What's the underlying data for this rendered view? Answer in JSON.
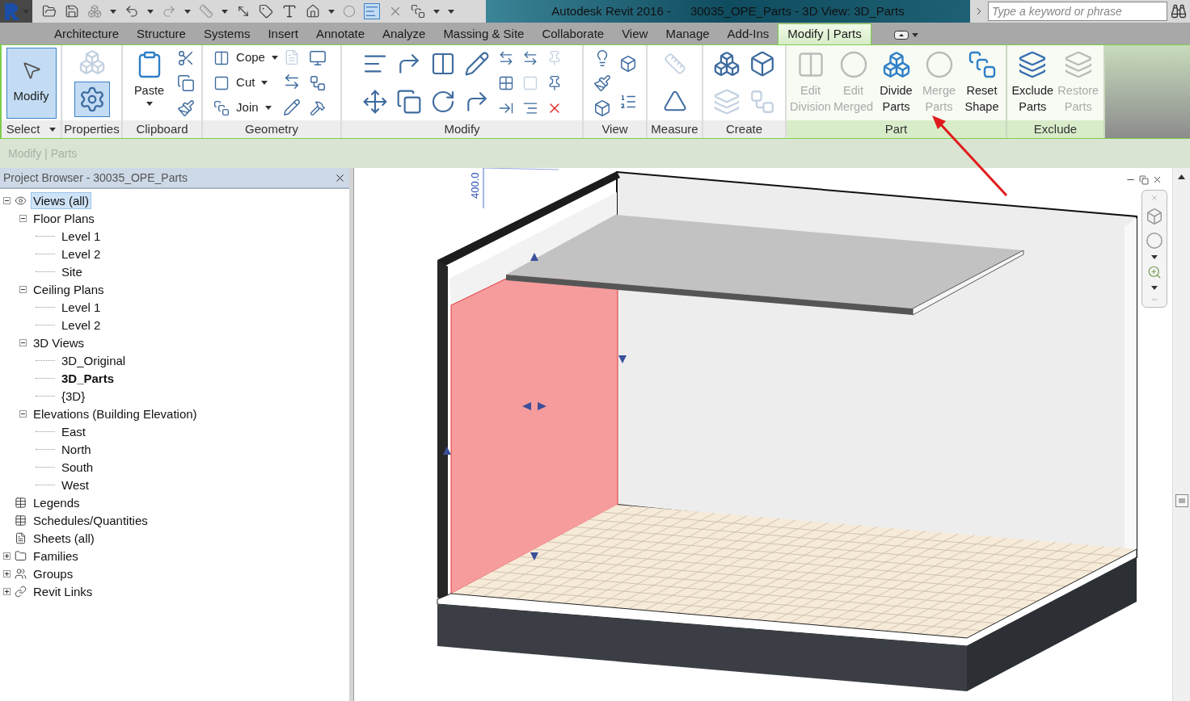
{
  "title_bar": {
    "app_name": "Autodesk Revit 2016 -",
    "document": "30035_OPE_Parts - 3D View: 3D_Parts",
    "search": {
      "placeholder": "Type a keyword or phrase"
    }
  },
  "tabs": [
    {
      "label": "Architecture",
      "selected": false
    },
    {
      "label": "Structure",
      "selected": false
    },
    {
      "label": "Systems",
      "selected": false
    },
    {
      "label": "Insert",
      "selected": false
    },
    {
      "label": "Annotate",
      "selected": false
    },
    {
      "label": "Analyze",
      "selected": false
    },
    {
      "label": "Massing & Site",
      "selected": false
    },
    {
      "label": "Collaborate",
      "selected": false
    },
    {
      "label": "View",
      "selected": false
    },
    {
      "label": "Manage",
      "selected": false
    },
    {
      "label": "Add-Ins",
      "selected": false
    },
    {
      "label": "Modify | Parts",
      "selected": true
    }
  ],
  "ribbon": {
    "panels": [
      {
        "title": "Select",
        "dropdown": true,
        "contextual": false,
        "tools": [
          {
            "kind": "large",
            "label": "Modify",
            "selected": true,
            "dropdown": false,
            "disabled": false
          }
        ]
      },
      {
        "title": "Properties",
        "dropdown": false,
        "contextual": false
      },
      {
        "title": "Clipboard",
        "dropdown": false,
        "contextual": false,
        "tools": [
          {
            "kind": "large",
            "label": "Paste",
            "dropdown": true,
            "disabled": false
          }
        ]
      },
      {
        "title": "Geometry",
        "dropdown": false,
        "contextual": false,
        "tools": [
          {
            "kind": "row",
            "label": "Cope",
            "dropdown": true,
            "disabled": false
          },
          {
            "kind": "row",
            "label": "Cut",
            "dropdown": true,
            "disabled": false
          },
          {
            "kind": "row",
            "label": "Join",
            "dropdown": true,
            "disabled": false
          }
        ]
      },
      {
        "title": "Modify",
        "dropdown": false,
        "contextual": false
      },
      {
        "title": "View",
        "dropdown": false,
        "contextual": false
      },
      {
        "title": "Measure",
        "dropdown": false,
        "contextual": false
      },
      {
        "title": "Create",
        "dropdown": false,
        "contextual": false
      },
      {
        "title": "Part",
        "dropdown": false,
        "contextual": true,
        "tools": [
          {
            "kind": "large",
            "label": "Edit Division",
            "dropdown": false,
            "disabled": true
          },
          {
            "kind": "large",
            "label": "Edit Merged",
            "dropdown": false,
            "disabled": true
          },
          {
            "kind": "large",
            "label": "Divide Parts",
            "dropdown": false,
            "disabled": false
          },
          {
            "kind": "large",
            "label": "Merge Parts",
            "dropdown": false,
            "disabled": true
          },
          {
            "kind": "large",
            "label": "Reset Shape",
            "dropdown": false,
            "disabled": false
          }
        ]
      },
      {
        "title": "Exclude",
        "dropdown": false,
        "contextual": true,
        "tools": [
          {
            "kind": "large",
            "label": "Exclude Parts",
            "dropdown": false,
            "disabled": false
          },
          {
            "kind": "large",
            "label": "Restore Parts",
            "dropdown": false,
            "disabled": true
          }
        ]
      }
    ]
  },
  "context_bar": {
    "label": "Modify | Parts"
  },
  "project_browser": {
    "title": "Project Browser - 30035_OPE_Parts",
    "tree": [
      {
        "label": "Views (all)",
        "kind": "view-set",
        "expanded": true,
        "selected": true,
        "children": [
          {
            "label": "Floor Plans",
            "expanded": true,
            "selected": false,
            "children": [
              {
                "label": "Level 1",
                "selected": false
              },
              {
                "label": "Level 2",
                "selected": false
              },
              {
                "label": "Site",
                "selected": false
              }
            ]
          },
          {
            "label": "Ceiling Plans",
            "expanded": true,
            "selected": false,
            "children": [
              {
                "label": "Level 1",
                "selected": false
              },
              {
                "label": "Level 2",
                "selected": false
              }
            ]
          },
          {
            "label": "3D Views",
            "expanded": true,
            "selected": false,
            "children": [
              {
                "label": "3D_Original",
                "selected": false,
                "active": false
              },
              {
                "label": "3D_Parts",
                "selected": false,
                "active": true
              },
              {
                "label": "{3D}",
                "selected": false,
                "active": false
              }
            ]
          },
          {
            "label": "Elevations (Building Elevation)",
            "expanded": true,
            "selected": false,
            "children": [
              {
                "label": "East",
                "selected": false
              },
              {
                "label": "North",
                "selected": false
              },
              {
                "label": "South",
                "selected": false
              },
              {
                "label": "West",
                "selected": false
              }
            ]
          }
        ]
      },
      {
        "label": "Legends",
        "kind": "legend-set",
        "selected": false
      },
      {
        "label": "Schedules/Quantities",
        "kind": "schedule-set",
        "selected": false
      },
      {
        "label": "Sheets (all)",
        "kind": "sheet-set",
        "selected": false
      },
      {
        "label": "Families",
        "kind": "family-set",
        "expanded": false,
        "selected": false
      },
      {
        "label": "Groups",
        "kind": "group-set",
        "expanded": false,
        "selected": false
      },
      {
        "label": "Revit Links",
        "kind": "link-set",
        "expanded": false,
        "selected": false
      }
    ]
  },
  "viewport": {
    "dimension": "400.0"
  }
}
